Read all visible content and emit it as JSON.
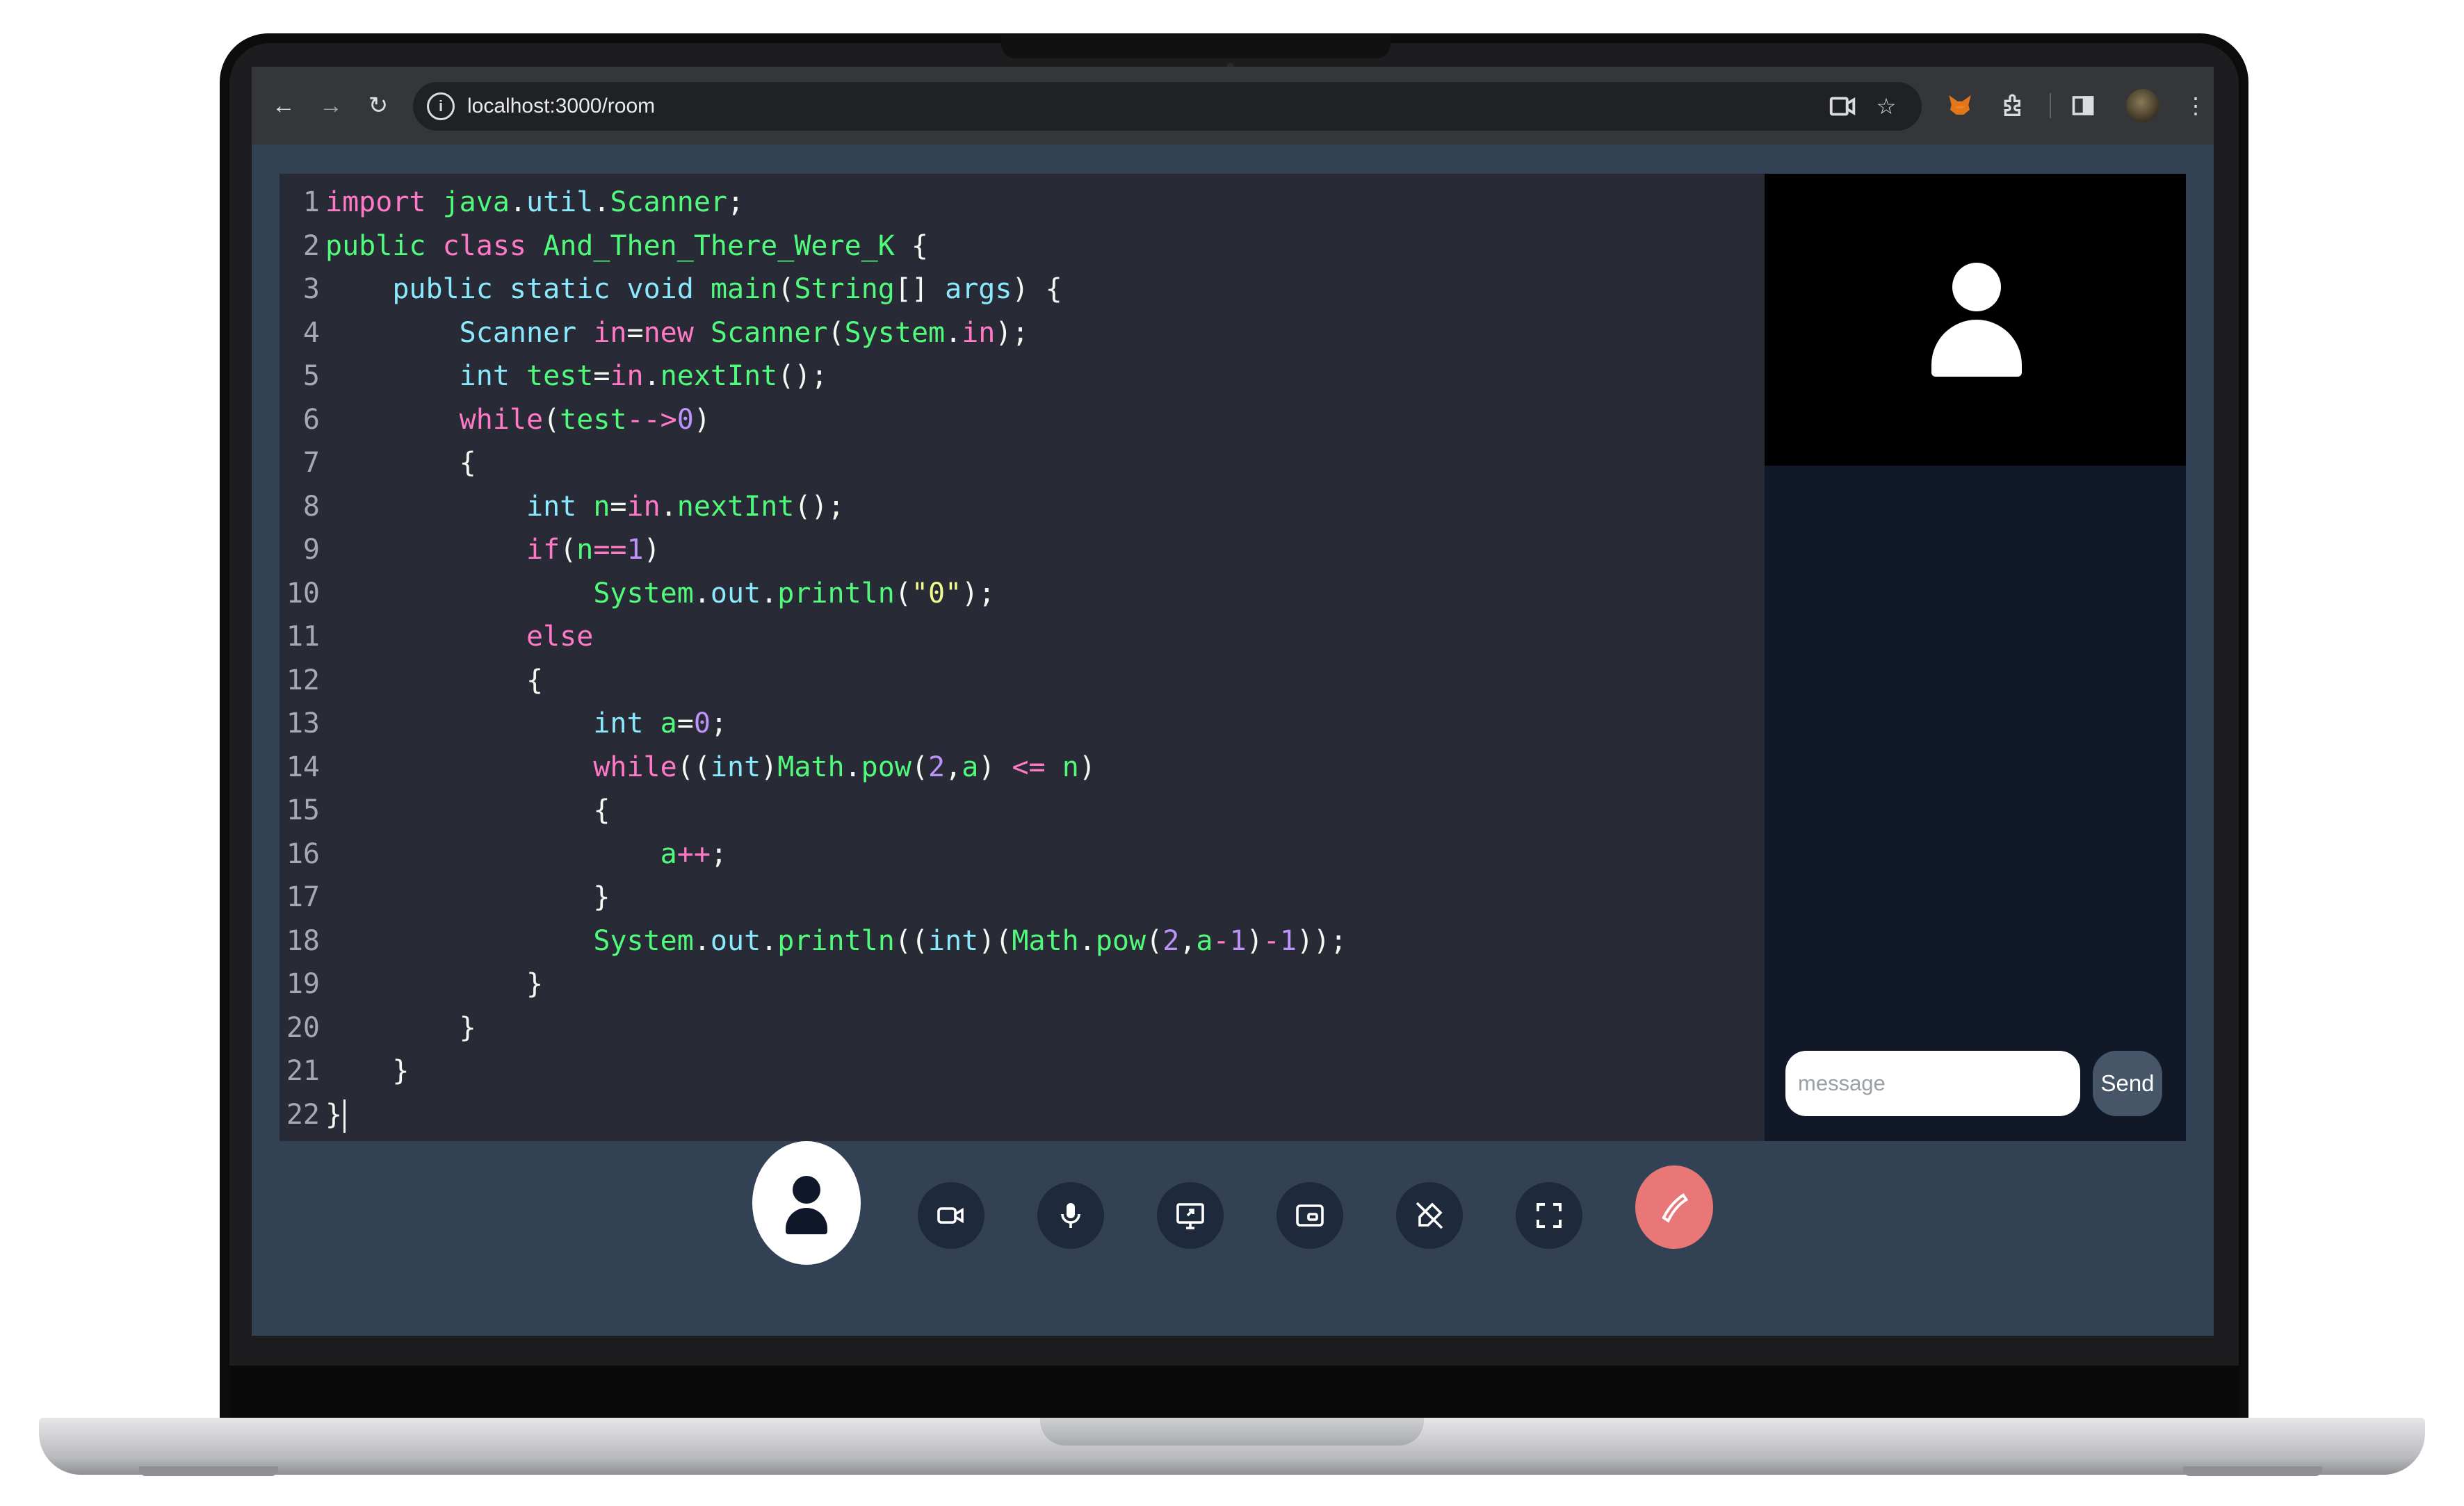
{
  "browser": {
    "url": "localhost:3000/room",
    "icons": {
      "back": "arrow-left-icon",
      "forward": "arrow-right-icon",
      "reload": "reload-icon",
      "site_info": "info-icon",
      "cast": "camera-icon",
      "bookmark": "star-icon",
      "metamask": "fox-extension-icon",
      "extensions": "puzzle-icon",
      "sidepanel": "side-panel-icon",
      "profile": "profile-avatar",
      "menu": "kebab-menu-icon"
    }
  },
  "editor": {
    "line_numbers": [
      "1",
      "2",
      "3",
      "4",
      "5",
      "6",
      "7",
      "8",
      "9",
      "10",
      "11",
      "12",
      "13",
      "14",
      "15",
      "16",
      "17",
      "18",
      "19",
      "20",
      "21",
      "22"
    ],
    "lines_text": [
      "import java.util.Scanner;",
      "public class And_Then_There_Were_K {",
      "    public static void main(String[] args) {",
      "        Scanner in=new Scanner(System.in);",
      "        int test=in.nextInt();",
      "        while(test-->0)",
      "        {",
      "            int n=in.nextInt();",
      "            if(n==1)",
      "                System.out.println(\"0\");",
      "            else",
      "            {",
      "                int a=0;",
      "                while((int)Math.pow(2,a) <= n)",
      "                {",
      "                    a++;",
      "                }",
      "                System.out.println((int)(Math.pow(2,a-1)-1));",
      "            }",
      "        }",
      "    }",
      "}"
    ]
  },
  "chat": {
    "input_placeholder": "message",
    "input_value": "",
    "send_label": "Send"
  },
  "video": {
    "placeholder_icon": "user-silhouette-icon"
  },
  "controls": {
    "items": [
      {
        "name": "profile-button",
        "icon": "user-icon"
      },
      {
        "name": "camera-toggle",
        "icon": "video-camera-icon"
      },
      {
        "name": "mic-toggle",
        "icon": "microphone-icon"
      },
      {
        "name": "screen-share",
        "icon": "screen-share-icon"
      },
      {
        "name": "picture-in-picture",
        "icon": "pip-icon"
      },
      {
        "name": "pen-off-toggle",
        "icon": "pen-off-icon"
      },
      {
        "name": "fullscreen-toggle",
        "icon": "fullscreen-icon"
      },
      {
        "name": "end-call",
        "icon": "phone-hangup-icon"
      }
    ],
    "end_call_color": "#ea7777"
  },
  "theme": {
    "page_bg": "#334155",
    "editor_bg": "#282a36",
    "panel_bg": "#111827",
    "keyword": "#ff79c6",
    "type": "#8be9fd",
    "class": "#50fa7b",
    "number": "#bd93f9",
    "string": "#f1fa8c"
  }
}
